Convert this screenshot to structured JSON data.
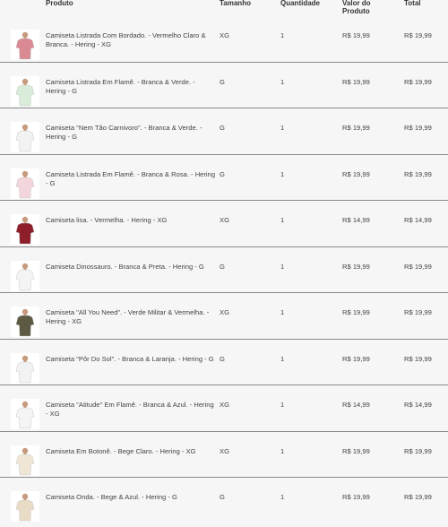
{
  "header": {
    "produto": "Produto",
    "tamanho": "Tamanho",
    "quantidade": "Quantidade",
    "valor": "Valor do Produto",
    "total": "Total"
  },
  "rows": [
    {
      "name": "Camiseta Listrada Com Bordado. - Vermelho Claro & Branca. - Hering - XG",
      "size": "XG",
      "qty": "1",
      "price": "R$ 19,99",
      "total": "R$ 19,99",
      "shirt_color": "#d98a92"
    },
    {
      "name": "Camiseta Listrada Em Flamê. - Branca & Verde. - Hering - G",
      "size": "G",
      "qty": "1",
      "price": "R$ 19,99",
      "total": "R$ 19,99",
      "shirt_color": "#d9ecd9"
    },
    {
      "name": "Camiseta \"Nem Tão Carnivoro\". - Branca & Verde. - Hering - G",
      "size": "G",
      "qty": "1",
      "price": "R$ 19,99",
      "total": "R$ 19,99",
      "shirt_color": "#f2f2f2"
    },
    {
      "name": "Camiseta Listrada Em Flamê. - Branca & Rosa. - Hering - G",
      "size": "G",
      "qty": "1",
      "price": "R$ 19,99",
      "total": "R$ 19,99",
      "shirt_color": "#f3d6dc"
    },
    {
      "name": "Camiseta lisa. - Vermelha. - Hering - XG",
      "size": "XG",
      "qty": "1",
      "price": "R$ 14,99",
      "total": "R$ 14,99",
      "shirt_color": "#8e1f2a"
    },
    {
      "name": "Camiseta Dinossauro. - Branca & Preta. - Hering - G",
      "size": "G",
      "qty": "1",
      "price": "R$ 19,99",
      "total": "R$ 19,99",
      "shirt_color": "#f4f4f4"
    },
    {
      "name": "Camiseta \"All You Need\". - Verde Militar & Vermelha. - Hering - XG",
      "size": "XG",
      "qty": "1",
      "price": "R$ 19,99",
      "total": "R$ 19,99",
      "shirt_color": "#5d5a44"
    },
    {
      "name": "Camiseta \"Pôr Do Sol\". - Branca & Laranja. - Hering - G",
      "size": "G",
      "qty": "1",
      "price": "R$ 19,99",
      "total": "R$ 19,99",
      "shirt_color": "#f2f2f2"
    },
    {
      "name": "Camiseta \"Atitude\" Em Flamê. - Branca & Azul. - Hering - XG",
      "size": "XG",
      "qty": "1",
      "price": "R$ 14,99",
      "total": "R$ 14,99",
      "shirt_color": "#f4f4f4"
    },
    {
      "name": "Camiseta Em Botonê. - Bege Claro. - Hering - XG",
      "size": "XG",
      "qty": "1",
      "price": "R$ 19,99",
      "total": "R$ 19,99",
      "shirt_color": "#efe6d6"
    },
    {
      "name": "Camiseta Onda. - Bege & Azul. - Hering - G",
      "size": "G",
      "qty": "1",
      "price": "R$ 19,99",
      "total": "R$ 19,99",
      "shirt_color": "#e9dcc6"
    }
  ]
}
